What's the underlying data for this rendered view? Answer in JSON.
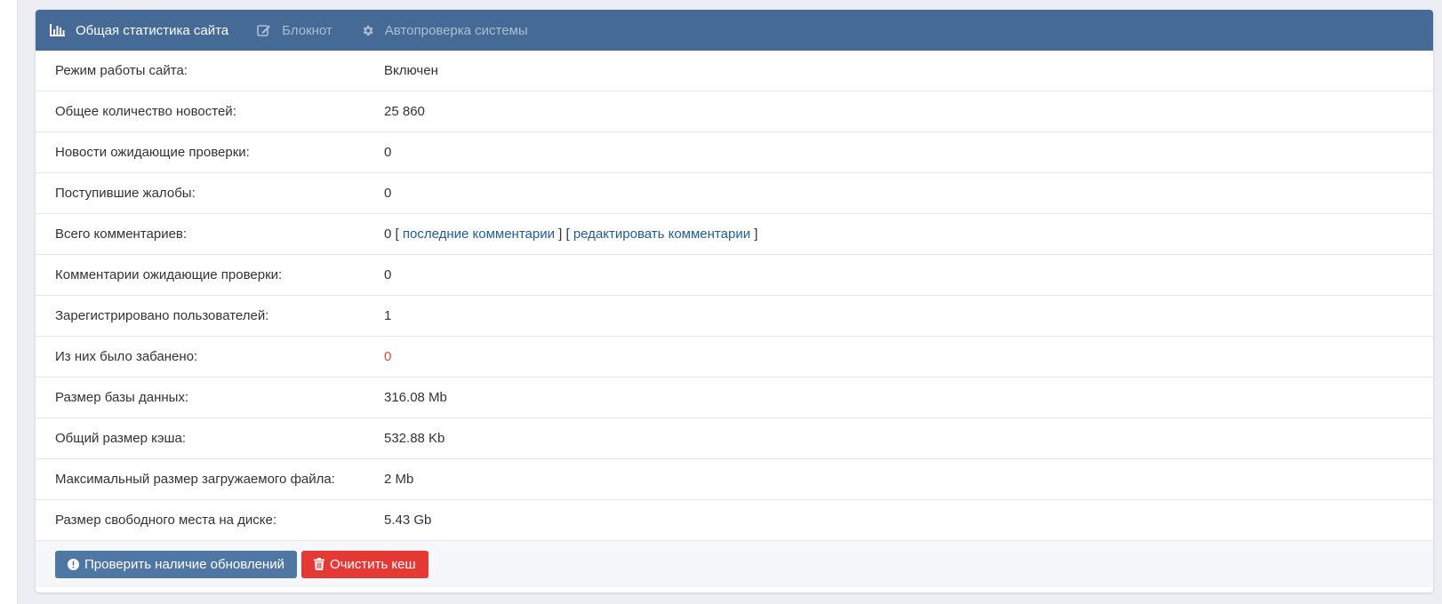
{
  "tabs": [
    {
      "label": "Общая статистика сайта",
      "icon": "bar-chart-icon",
      "active": true
    },
    {
      "label": "Блокнот",
      "icon": "edit-icon",
      "active": false
    },
    {
      "label": "Автопроверка системы",
      "icon": "gear-icon",
      "active": false
    }
  ],
  "stats": {
    "site_mode": {
      "label": "Режим работы сайта:",
      "value": "Включен"
    },
    "news_total": {
      "label": "Общее количество новостей:",
      "value": "25 860"
    },
    "news_pending": {
      "label": "Новости ожидающие проверки:",
      "value": "0"
    },
    "complaints": {
      "label": "Поступившие жалобы:",
      "value": "0"
    },
    "comments_total": {
      "label": "Всего комментариев:",
      "value": "0",
      "open_bracket_1": " [ ",
      "link_last": "последние комментарии",
      "separator": " ] [ ",
      "link_edit": "редактировать комментарии",
      "close_bracket": " ]"
    },
    "comments_pending": {
      "label": "Комментарии ожидающие проверки:",
      "value": "0"
    },
    "users_registered": {
      "label": "Зарегистрировано пользователей:",
      "value": "1"
    },
    "users_banned": {
      "label": "Из них было забанено:",
      "value": "0"
    },
    "db_size": {
      "label": "Размер базы данных:",
      "value": "316.08 Mb"
    },
    "cache_size": {
      "label": "Общий размер кэша:",
      "value": "532.88 Kb"
    },
    "max_upload": {
      "label": "Максимальный размер загружаемого файла:",
      "value": "2 Mb"
    },
    "free_disk": {
      "label": "Размер свободного места на диске:",
      "value": "5.43 Gb"
    }
  },
  "buttons": {
    "check_updates": "Проверить наличие обновлений",
    "clear_cache": "Очистить кеш"
  },
  "colors": {
    "header": "#456a95",
    "link": "#1e5e94",
    "banned_value": "#e0463a",
    "btn_blue": "#4e77a3",
    "btn_red": "#e53935"
  }
}
